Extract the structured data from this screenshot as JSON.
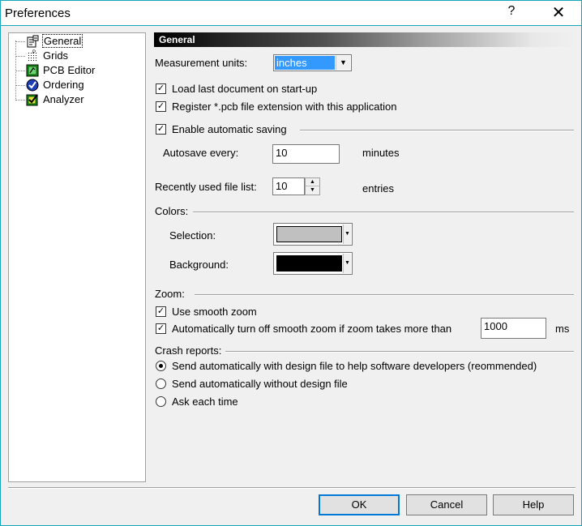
{
  "window": {
    "title": "Preferences",
    "help_glyph": "?",
    "close_glyph": "✕"
  },
  "tree": {
    "items": [
      {
        "label": "General",
        "icon": "general-icon"
      },
      {
        "label": "Grids",
        "icon": "grids-icon"
      },
      {
        "label": "PCB Editor",
        "icon": "pcb-editor-icon"
      },
      {
        "label": "Ordering",
        "icon": "ordering-icon"
      },
      {
        "label": "Analyzer",
        "icon": "analyzer-icon"
      }
    ]
  },
  "general": {
    "header": "General",
    "measurement_label": "Measurement units:",
    "measurement_value": "inches",
    "load_last_doc": "Load last document on start-up",
    "register_ext": "Register *.pcb file extension with this application",
    "enable_autosave": "Enable automatic saving",
    "autosave_label": "Autosave every:",
    "autosave_value": "10",
    "autosave_unit": "minutes",
    "recent_label": "Recently used file list:",
    "recent_value": "10",
    "recent_unit": "entries",
    "colors_label": "Colors:",
    "selection_label": "Selection:",
    "selection_color": "#c0c0c0",
    "background_label": "Background:",
    "background_color": "#000000",
    "zoom_label": "Zoom:",
    "smooth_zoom": "Use smooth zoom",
    "auto_off_zoom": "Automatically turn off smooth zoom if zoom takes more than",
    "zoom_ms_value": "1000",
    "zoom_ms_unit": "ms",
    "crash_label": "Crash reports:",
    "crash_opt1": "Send automatically with design file to help software developers (reommended)",
    "crash_opt2": "Send automatically without design file",
    "crash_opt3": "Ask each time",
    "check_glyph": "✓"
  },
  "buttons": {
    "ok": "OK",
    "cancel": "Cancel",
    "help": "Help"
  }
}
